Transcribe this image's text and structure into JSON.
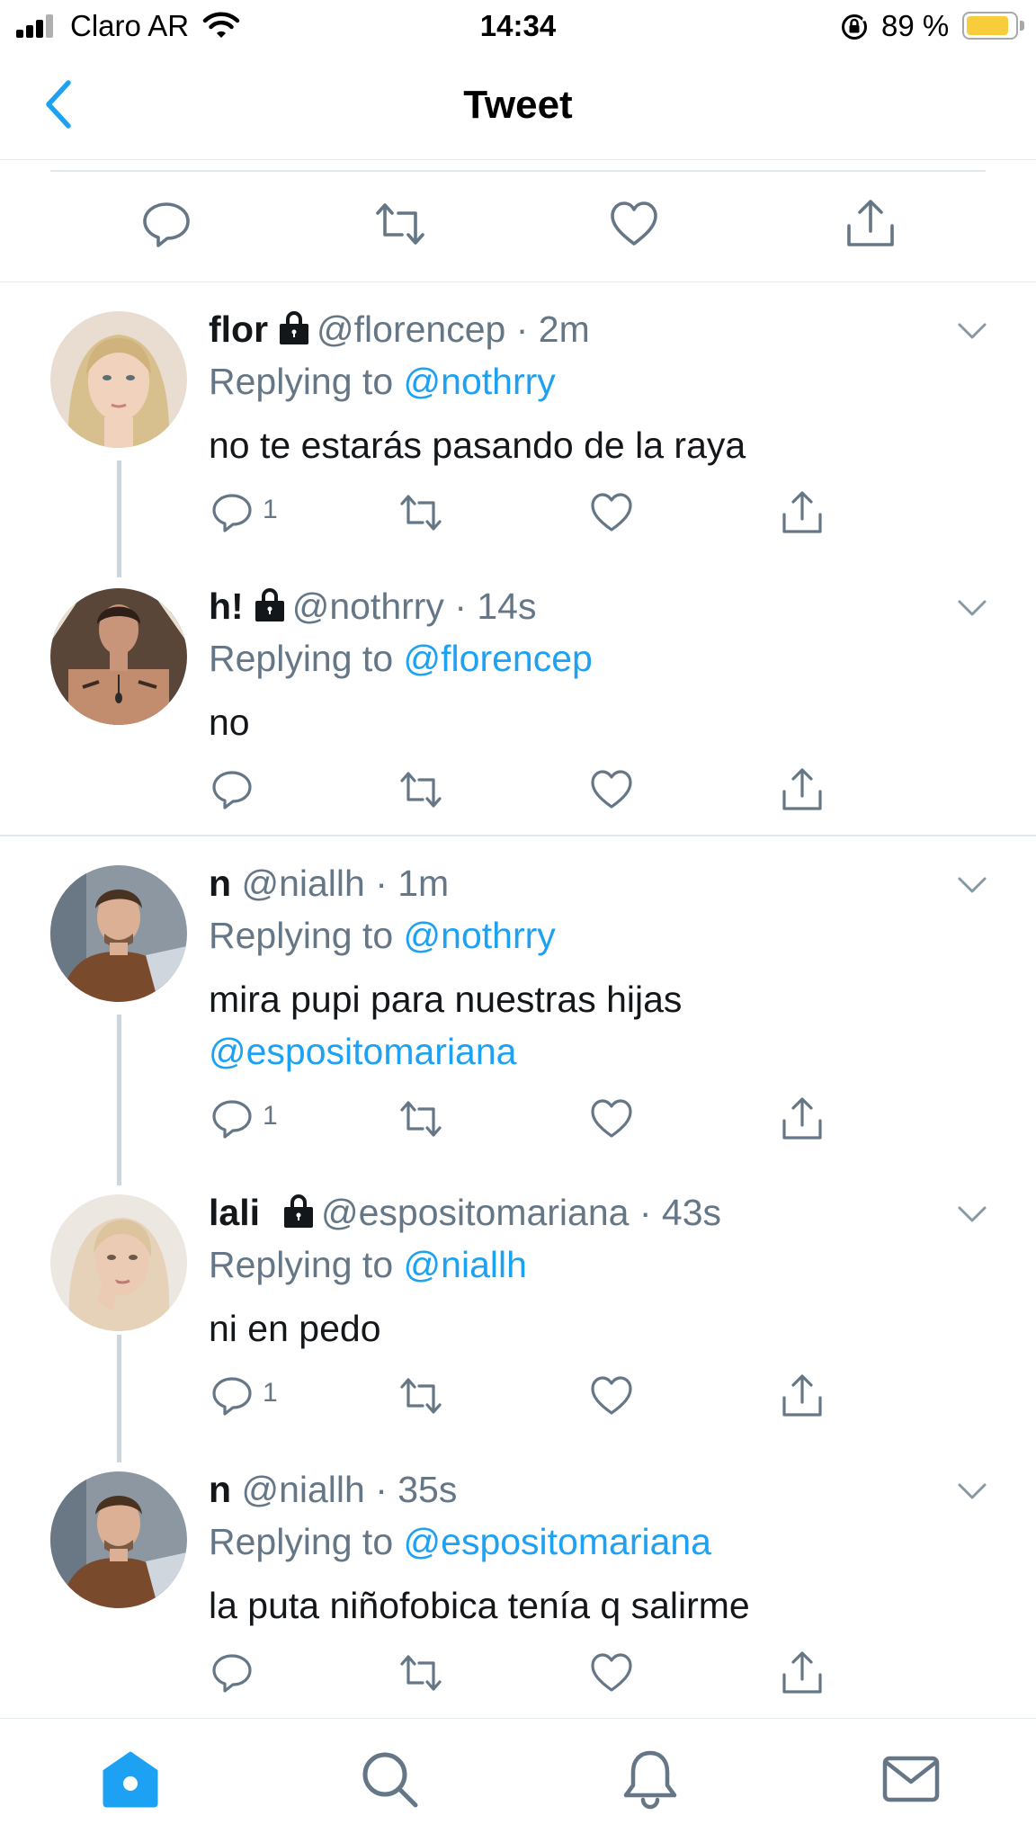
{
  "status_bar": {
    "carrier": "Claro AR",
    "time": "14:34",
    "battery_percent": "89 %",
    "battery_level": 0.89,
    "icons": [
      "signal-bars-icon",
      "wifi-icon",
      "rotation-lock-icon",
      "battery-icon"
    ]
  },
  "nav": {
    "title": "Tweet",
    "back_icon": "chevron-left-icon"
  },
  "colors": {
    "accent": "#1da1f2",
    "secondary_text": "#657786",
    "primary_text": "#14171a",
    "divider": "#e1e8ed",
    "battery": "#f7cd3b"
  },
  "main_actions": [
    "reply-icon",
    "retweet-icon",
    "like-icon",
    "share-icon"
  ],
  "replies": [
    {
      "name": "flor",
      "locked": true,
      "handle": "@florencep",
      "dot": "·",
      "time": "2m",
      "replying_prefix": "Replying to",
      "replying_to": "@nothrry",
      "text_lines": [
        "no te estarás pasando de la raya"
      ],
      "reply_count": "1"
    },
    {
      "name": "h!",
      "locked": true,
      "handle": "@nothrry",
      "dot": "·",
      "time": "14s",
      "replying_prefix": "Replying to",
      "replying_to": "@florencep",
      "text_lines": [
        "no"
      ],
      "reply_count": ""
    },
    {
      "name": "n",
      "locked": false,
      "handle": "@niallh",
      "dot": "·",
      "time": "1m",
      "replying_prefix": "Replying to",
      "replying_to": "@nothrry",
      "text_lines": [
        "mira pupi para nuestras hijas"
      ],
      "text_mention": "@espositomariana",
      "reply_count": "1"
    },
    {
      "name": "lali",
      "locked": true,
      "handle": "@espositomariana",
      "dot": "·",
      "time": "43s",
      "replying_prefix": "Replying to",
      "replying_to": "@niallh",
      "text_lines": [
        "ni en pedo"
      ],
      "reply_count": "1"
    },
    {
      "name": "n",
      "locked": false,
      "handle": "@niallh",
      "dot": "·",
      "time": "35s",
      "replying_prefix": "Replying to",
      "replying_to": "@espositomariana",
      "text_lines": [
        "la puta niñofobica tenía q salirme"
      ],
      "reply_count": ""
    }
  ],
  "tab_bar": [
    "home-icon",
    "search-icon",
    "notifications-icon",
    "messages-icon"
  ]
}
